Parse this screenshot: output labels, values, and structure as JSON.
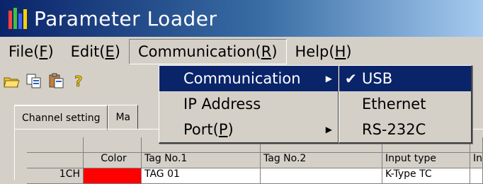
{
  "window": {
    "title": "Parameter Loader"
  },
  "menubar": {
    "file": "File(F)",
    "file_main": "File(",
    "file_key": "F",
    "file_close": ")",
    "edit_main": "Edit(",
    "edit_key": "E",
    "edit_close": ")",
    "comm_main": "Communication(",
    "comm_key": "R",
    "comm_close": ")",
    "help_main": "Help(",
    "help_key": "H",
    "help_close": ")"
  },
  "toolbar": {
    "icons": [
      "open-icon",
      "copy-icon",
      "paste-icon",
      "help-icon"
    ]
  },
  "comm_menu": {
    "items": [
      {
        "label": "Communication",
        "has_submenu": true,
        "highlighted": true
      },
      {
        "label": "IP Address"
      },
      {
        "label_main": "Port(",
        "label_key": "P",
        "label_close": ")",
        "has_submenu": true
      }
    ]
  },
  "comm_submenu": {
    "items": [
      {
        "label": "USB",
        "checked": true,
        "highlighted": true
      },
      {
        "label": "Ethernet"
      },
      {
        "label": "RS-232C"
      }
    ]
  },
  "tabs": [
    {
      "label": "Channel setting",
      "active": true
    },
    {
      "label": "Ma"
    }
  ],
  "grid": {
    "headers": [
      "",
      "Color",
      "Tag No.1",
      "Tag No.2",
      "Input type",
      "In"
    ],
    "row1": {
      "ch": "1CH",
      "color": "#ff0000",
      "tag1": "TAG 01",
      "tag2": "",
      "input": "K-Type TC"
    }
  },
  "colors": {
    "titlebar_start": "#0a246a",
    "highlight": "#0a246a",
    "face": "#d4d0c8"
  }
}
